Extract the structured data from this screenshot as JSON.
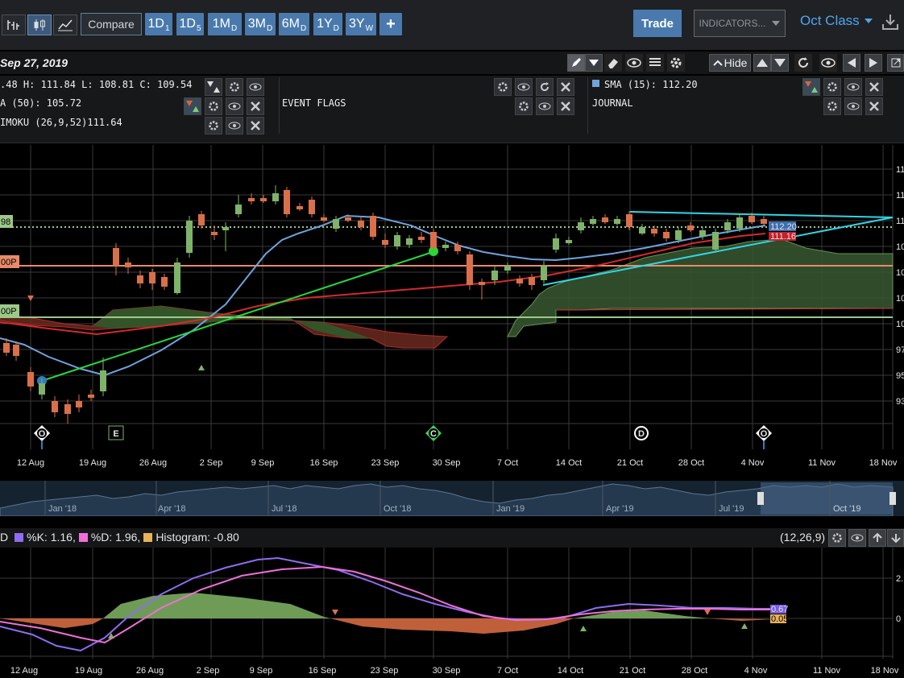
{
  "toolbar": {
    "compare_label": "Compare",
    "period_buttons": [
      {
        "main": "1D",
        "sub": "1"
      },
      {
        "main": "1D",
        "sub": "5"
      },
      {
        "main": "1M",
        "sub": "D"
      },
      {
        "main": "3M",
        "sub": "D"
      },
      {
        "main": "6M",
        "sub": "D"
      },
      {
        "main": "1Y",
        "sub": "D"
      },
      {
        "main": "3Y",
        "sub": "W"
      }
    ],
    "add_label": "+",
    "trade_label": "Trade",
    "indicators_label": "INDICATORS...",
    "account_label": "Oct Class"
  },
  "date_bar": {
    "date": "Sep 27, 2019",
    "hide_label": "Hide"
  },
  "legend": {
    "ohlc": ".48 H: 111.84 L: 108.81 C: 109.54",
    "ma50": "A (50): 105.72",
    "ichimoku": "IMOKU (26,9,52)111.64",
    "event_flags": "EVENT FLAGS",
    "sma15": "SMA (15): 112.20",
    "journal": "JOURNAL"
  },
  "main_chart": {
    "price_tags": [
      {
        "label": "98",
        "color": "#9bc98a"
      },
      {
        "label": "00P",
        "color": "#e88a68"
      },
      {
        "label": "00P",
        "color": "#9bc98a"
      }
    ],
    "last_price_tags": [
      {
        "label": "112.20",
        "color": "#3d6fb0"
      },
      {
        "label": "111.16",
        "color": "#c4202a"
      }
    ],
    "right_axis_labels": [
      "11",
      "11",
      "11",
      "10",
      "10",
      "10",
      "10",
      "97",
      "95",
      "93"
    ],
    "x_labels": [
      "12 Aug",
      "19 Aug",
      "26 Aug",
      "2 Sep",
      "9 Sep",
      "16 Sep",
      "23 Sep",
      "30 Sep",
      "7 Oct",
      "14 Oct",
      "21 Oct",
      "28 Oct",
      "4 Nov",
      "11 Nov",
      "18 Nov"
    ],
    "event_markers": [
      "O",
      "E",
      "C",
      "D",
      "O"
    ]
  },
  "navigator": {
    "labels": [
      "Jan '18",
      "Apr '18",
      "Jul '18",
      "Oct '18",
      "Jan '19",
      "Apr '19",
      "Jul '19",
      "Oct '19"
    ]
  },
  "macd": {
    "label_prefix": "D",
    "k": "%K: 1.16,",
    "d": "%D: 1.96,",
    "hist": "Histogram: -0.80",
    "params": "(12,26,9)",
    "tags": [
      {
        "label": "0.67",
        "color": "#7c5ce0"
      },
      {
        "label": "0.05",
        "color": "#e8b25a"
      }
    ],
    "right_axis_labels": [
      "2.",
      "0"
    ],
    "x_labels": [
      "12 Aug",
      "19 Aug",
      "26 Aug",
      "2 Sep",
      "9 Sep",
      "16 Sep",
      "23 Sep",
      "30 Sep",
      "7 Oct",
      "14 Oct",
      "21 Oct",
      "28 Oct",
      "4 Nov",
      "11 Nov",
      "18 Nov"
    ]
  },
  "colors": {
    "up": "#7fb36a",
    "down": "#d9704a",
    "sma_blue": "#6fa3dc",
    "ma_red": "#d42a2a",
    "trend_cyan": "#2fd6e8",
    "trend_green": "#26d93a",
    "k_purple": "#8f6cf0",
    "d_pink": "#ef6fd8"
  }
}
